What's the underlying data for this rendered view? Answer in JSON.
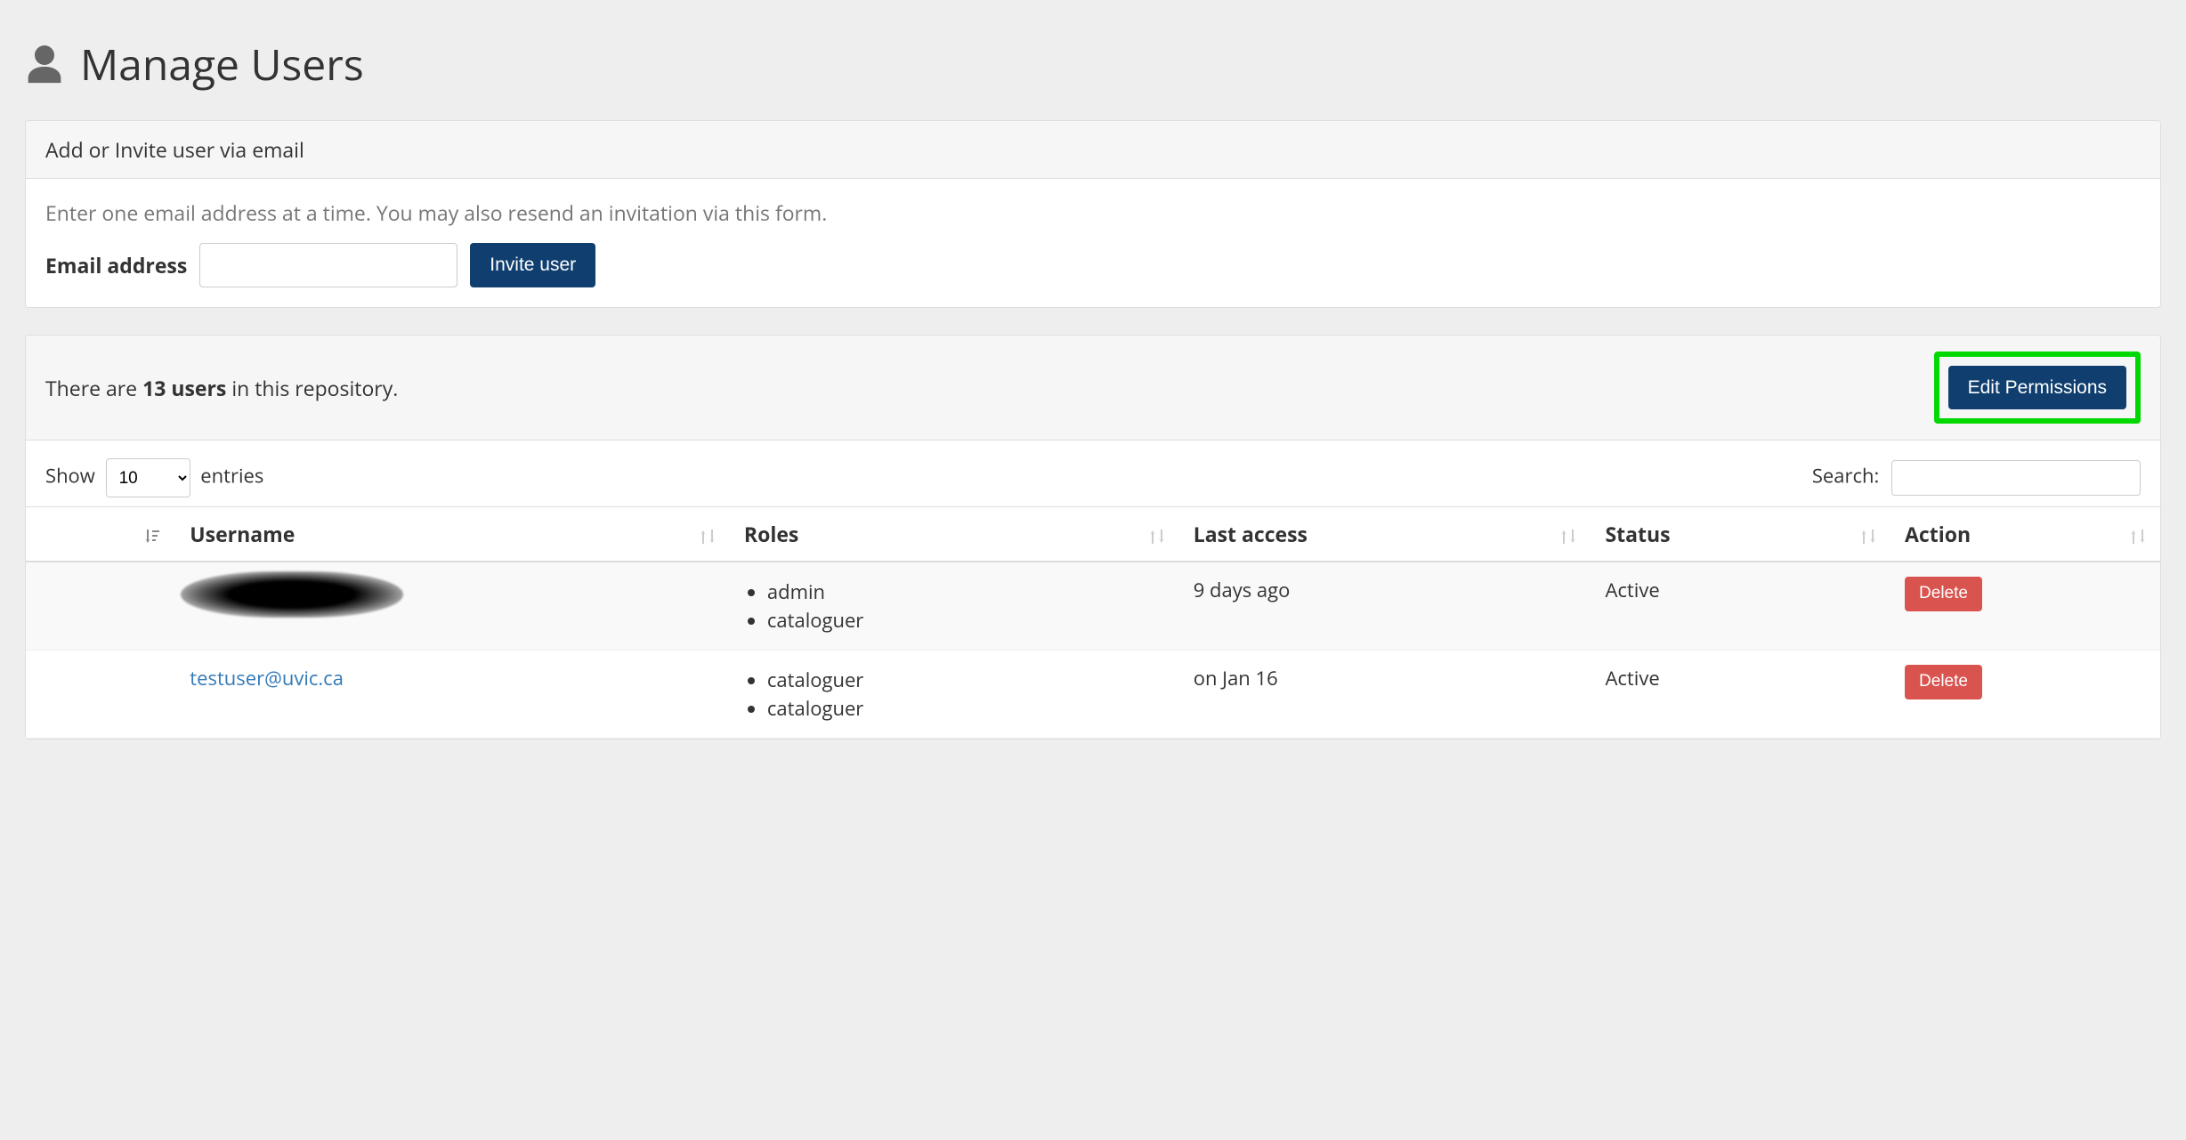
{
  "page": {
    "title": "Manage Users"
  },
  "invite": {
    "panel_title": "Add or Invite user via email",
    "help_text": "Enter one email address at a time. You may also resend an invitation via this form.",
    "email_label": "Email address",
    "invite_button": "Invite user"
  },
  "repo": {
    "count_prefix": "There are ",
    "count_bold": "13 users",
    "count_suffix": " in this repository.",
    "edit_permissions_button": "Edit Permissions"
  },
  "table": {
    "show_label": "Show",
    "entries_label": "entries",
    "page_size": "10",
    "search_label": "Search:",
    "columns": {
      "username": "Username",
      "roles": "Roles",
      "last_access": "Last access",
      "status": "Status",
      "action": "Action"
    },
    "rows": [
      {
        "username": "",
        "username_redacted": true,
        "roles": [
          "admin",
          "cataloguer"
        ],
        "last_access": "9 days ago",
        "status": "Active",
        "action": "Delete"
      },
      {
        "username": "testuser@uvic.ca",
        "username_redacted": false,
        "roles": [
          "cataloguer",
          "cataloguer"
        ],
        "last_access": "on Jan 16",
        "status": "Active",
        "action": "Delete"
      }
    ]
  }
}
